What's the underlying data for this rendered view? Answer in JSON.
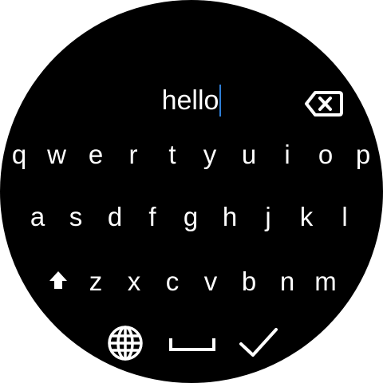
{
  "input": {
    "value": "hello",
    "cursor_color": "#2f7fd7"
  },
  "keyboard": {
    "row1": [
      "q",
      "w",
      "e",
      "r",
      "t",
      "y",
      "u",
      "i",
      "o",
      "p"
    ],
    "row2": [
      "a",
      "s",
      "d",
      "f",
      "g",
      "h",
      "j",
      "k",
      "l"
    ],
    "row3": [
      "z",
      "x",
      "c",
      "v",
      "b",
      "n",
      "m"
    ],
    "icons": {
      "backspace": "backspace-icon",
      "shift": "shift-arrow-icon",
      "language": "globe-icon",
      "space": "spacebar-icon",
      "done": "checkmark-icon"
    }
  },
  "colors": {
    "background": "#000000",
    "key_text": "#ffffff",
    "accent": "#2f7fd7"
  }
}
